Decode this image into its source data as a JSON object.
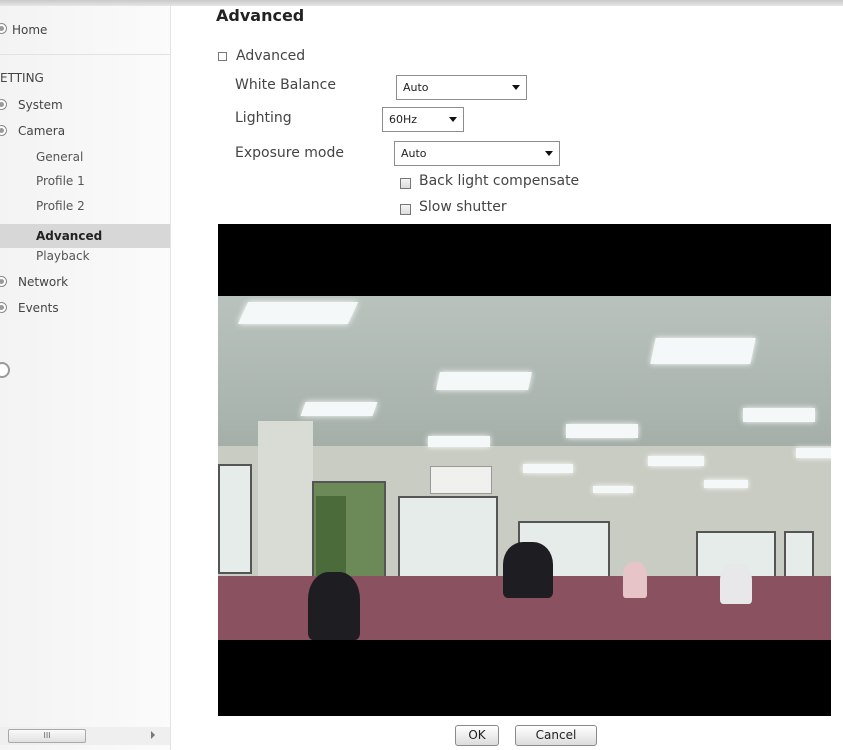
{
  "sidebar": {
    "home": "Home",
    "setting": "ETTING",
    "system": "System",
    "camera": "Camera",
    "camera_items": [
      "General",
      "Profile 1",
      "Profile 2",
      "Advanced",
      "Playback"
    ],
    "network": "Network",
    "events": "Events",
    "scroll_grip": "III"
  },
  "main": {
    "title": "Advanced",
    "section": "Advanced",
    "white_balance": {
      "label": "White Balance",
      "value": "Auto"
    },
    "lighting": {
      "label": "Lighting",
      "value": "60Hz"
    },
    "exposure": {
      "label": "Exposure mode",
      "value": "Auto"
    },
    "back_light": "Back light compensate",
    "slow_shutter": "Slow shutter"
  },
  "buttons": {
    "ok": "OK",
    "cancel": "Cancel"
  }
}
